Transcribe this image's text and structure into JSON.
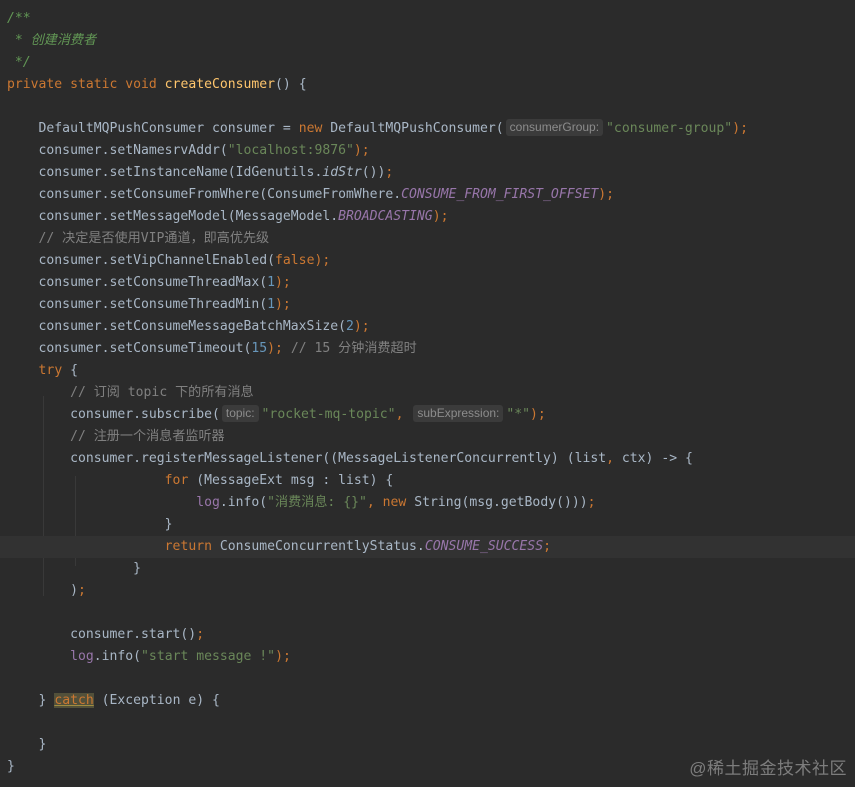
{
  "editor": {
    "colors": {
      "background": "#2b2b2b",
      "text": "#a9b7c6",
      "keyword": "#cc7832",
      "method_declaration": "#ffc66d",
      "string": "#6a8759",
      "number": "#6897bb",
      "constant": "#9876aa",
      "comment": "#808080",
      "doc_comment": "#629755",
      "caret_row": "#323232"
    },
    "lines": [
      [
        {
          "t": "/**",
          "c": "doc"
        }
      ],
      [
        {
          "t": " * 创建消费者",
          "c": "doc"
        }
      ],
      [
        {
          "t": " */",
          "c": "doc"
        }
      ],
      [
        {
          "t": "private static void ",
          "c": "kw"
        },
        {
          "t": "createConsumer",
          "c": "fn"
        },
        {
          "t": "() {",
          "c": "plain"
        }
      ],
      [],
      [
        {
          "t": "    DefaultMQPushConsumer consumer = ",
          "c": "plain"
        },
        {
          "t": "new ",
          "c": "kw"
        },
        {
          "t": "DefaultMQPushConsumer(",
          "c": "plain"
        },
        {
          "t": "consumerGroup:",
          "c": "hint"
        },
        {
          "t": "\"consumer-group\"",
          "c": "str"
        },
        {
          "t": ");",
          "c": "kw"
        }
      ],
      [
        {
          "t": "    consumer.setNamesrvAddr(",
          "c": "plain"
        },
        {
          "t": "\"localhost:9876\"",
          "c": "str"
        },
        {
          "t": ");",
          "c": "kw"
        }
      ],
      [
        {
          "t": "    consumer.setInstanceName(IdGenutils.",
          "c": "plain"
        },
        {
          "t": "idStr",
          "c": "st"
        },
        {
          "t": "())",
          "c": "plain"
        },
        {
          "t": ";",
          "c": "kw"
        }
      ],
      [
        {
          "t": "    consumer.setConsumeFromWhere(ConsumeFromWhere.",
          "c": "plain"
        },
        {
          "t": "CONSUME_FROM_FIRST_OFFSET",
          "c": "cst"
        },
        {
          "t": ");",
          "c": "kw"
        }
      ],
      [
        {
          "t": "    consumer.setMessageModel(MessageModel.",
          "c": "plain"
        },
        {
          "t": "BROADCASTING",
          "c": "cst"
        },
        {
          "t": ");",
          "c": "kw"
        }
      ],
      [
        {
          "t": "    // 决定是否使用VIP通道，即高优先级",
          "c": "cmt"
        }
      ],
      [
        {
          "t": "    consumer.setVipChannelEnabled(",
          "c": "plain"
        },
        {
          "t": "false",
          "c": "kw"
        },
        {
          "t": ");",
          "c": "kw"
        }
      ],
      [
        {
          "t": "    consumer.setConsumeThreadMax(",
          "c": "plain"
        },
        {
          "t": "1",
          "c": "num"
        },
        {
          "t": ");",
          "c": "kw"
        }
      ],
      [
        {
          "t": "    consumer.setConsumeThreadMin(",
          "c": "plain"
        },
        {
          "t": "1",
          "c": "num"
        },
        {
          "t": ");",
          "c": "kw"
        }
      ],
      [
        {
          "t": "    consumer.setConsumeMessageBatchMaxSize(",
          "c": "plain"
        },
        {
          "t": "2",
          "c": "num"
        },
        {
          "t": ");",
          "c": "kw"
        }
      ],
      [
        {
          "t": "    consumer.setConsumeTimeout(",
          "c": "plain"
        },
        {
          "t": "15",
          "c": "num"
        },
        {
          "t": "); ",
          "c": "kw"
        },
        {
          "t": "// 15 分钟消费超时",
          "c": "cmt"
        }
      ],
      [
        {
          "t": "    ",
          "c": "plain"
        },
        {
          "t": "try ",
          "c": "kw"
        },
        {
          "t": "{",
          "c": "plain"
        }
      ],
      [
        {
          "t": "        // 订阅 topic 下的所有消息",
          "c": "cmt"
        }
      ],
      [
        {
          "t": "        consumer.subscribe(",
          "c": "plain"
        },
        {
          "t": "topic:",
          "c": "hint"
        },
        {
          "t": "\"rocket-mq-topic\"",
          "c": "str"
        },
        {
          "t": ", ",
          "c": "kw"
        },
        {
          "t": "subExpression:",
          "c": "hint"
        },
        {
          "t": "\"*\"",
          "c": "str"
        },
        {
          "t": ");",
          "c": "kw"
        }
      ],
      [
        {
          "t": "        // 注册一个消息者监听器",
          "c": "cmt"
        }
      ],
      [
        {
          "t": "        consumer.registerMessageListener((MessageListenerConcurrently) (list",
          "c": "plain"
        },
        {
          "t": ", ",
          "c": "kw"
        },
        {
          "t": "ctx) -> {",
          "c": "plain"
        }
      ],
      [
        {
          "t": "                    ",
          "c": "plain"
        },
        {
          "t": "for ",
          "c": "kw"
        },
        {
          "t": "(MessageExt msg : list) {",
          "c": "plain"
        }
      ],
      [
        {
          "t": "                        ",
          "c": "plain"
        },
        {
          "t": "log",
          "c": "fld"
        },
        {
          "t": ".info(",
          "c": "plain"
        },
        {
          "t": "\"消费消息: {}\"",
          "c": "str"
        },
        {
          "t": ", ",
          "c": "kw"
        },
        {
          "t": "new ",
          "c": "kw"
        },
        {
          "t": "String(msg.getBody()))",
          "c": "plain"
        },
        {
          "t": ";",
          "c": "kw"
        }
      ],
      [
        {
          "t": "                    }",
          "c": "plain"
        }
      ],
      [
        {
          "t": "                    ",
          "c": "plain"
        },
        {
          "t": "return ",
          "c": "kw"
        },
        {
          "t": "ConsumeConcurrentlyStatus.",
          "c": "plain"
        },
        {
          "t": "CONSUME_SUCCESS",
          "c": "cst"
        },
        {
          "t": ";",
          "c": "kw"
        }
      ],
      [
        {
          "t": "                }",
          "c": "plain"
        }
      ],
      [
        {
          "t": "        )",
          "c": "plain"
        },
        {
          "t": ";",
          "c": "kw"
        }
      ],
      [],
      [
        {
          "t": "        consumer.start()",
          "c": "plain"
        },
        {
          "t": ";",
          "c": "kw"
        }
      ],
      [
        {
          "t": "        ",
          "c": "plain"
        },
        {
          "t": "log",
          "c": "fld"
        },
        {
          "t": ".info(",
          "c": "plain"
        },
        {
          "t": "\"start message !\"",
          "c": "str"
        },
        {
          "t": ");",
          "c": "kw"
        }
      ],
      [],
      [
        {
          "t": "    } ",
          "c": "plain"
        },
        {
          "t": "catch",
          "c": "kwcatch"
        },
        {
          "t": " (Exception e) {",
          "c": "plain"
        }
      ],
      [],
      [
        {
          "t": "    }",
          "c": "plain"
        }
      ],
      [
        {
          "t": "}",
          "c": "plain"
        }
      ]
    ]
  },
  "watermark": {
    "text": "@稀土掘金技术社区"
  }
}
